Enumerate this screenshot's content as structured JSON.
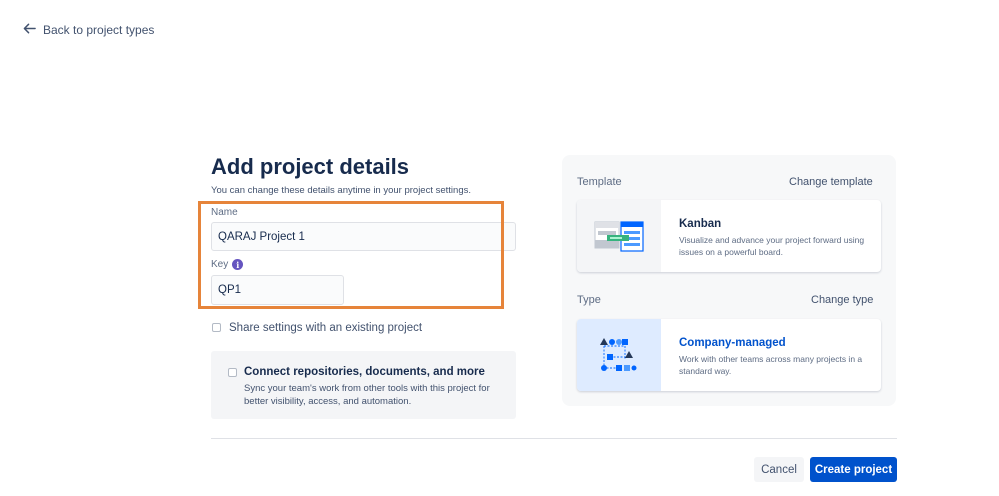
{
  "nav": {
    "back_label": "Back to project types"
  },
  "form": {
    "title": "Add project details",
    "subtitle": "You can change these details anytime in your project settings.",
    "name_label": "Name",
    "name_value": "QARAJ Project 1",
    "key_label": "Key",
    "key_info_glyph": "i",
    "key_value": "QP1",
    "share_label": "Share settings with an existing project",
    "connect_title": "Connect repositories, documents, and more",
    "connect_description": "Sync your team's work from other tools with this project for better visibility, access, and automation."
  },
  "template": {
    "section_label": "Template",
    "change_label": "Change template",
    "name": "Kanban",
    "description": "Visualize and advance your project forward using issues on a powerful board."
  },
  "type": {
    "section_label": "Type",
    "change_label": "Change type",
    "name": "Company-managed",
    "description": "Work with other teams across many projects in a standard way."
  },
  "footer": {
    "cancel_label": "Cancel",
    "create_label": "Create project"
  },
  "colors": {
    "primary": "#0052cc",
    "highlight_border": "#e6843a",
    "info_icon": "#6554c0",
    "type_name": "#0052cc"
  },
  "icons": {
    "back": "arrow-left-icon",
    "key_info": "info-icon",
    "template_thumb": "kanban-board-illustration",
    "type_thumb": "company-managed-illustration"
  }
}
